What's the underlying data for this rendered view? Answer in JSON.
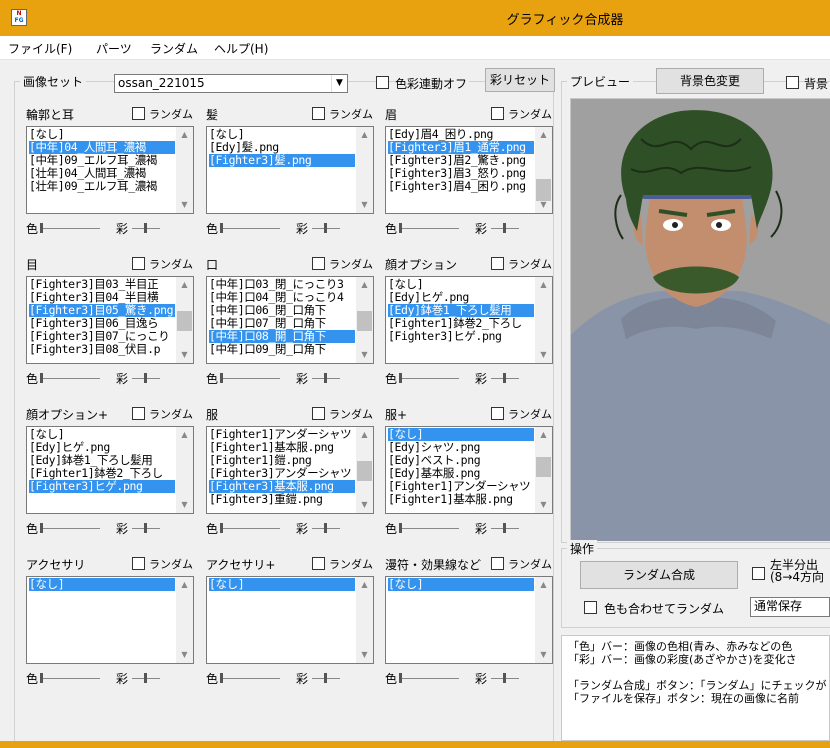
{
  "window": {
    "title": "グラフィック合成器"
  },
  "menu": [
    "ファイル(F)",
    "パーツ",
    "ランダム",
    "ヘルプ(H)"
  ],
  "image_set": {
    "label": "画像セット",
    "value": "ossan_221015",
    "color_link_label": "色彩連動オフ",
    "saturation_reset": "彩リセット"
  },
  "common": {
    "random": "ランダム",
    "color": "色",
    "saturation": "彩"
  },
  "parts": [
    {
      "label": "輪郭と耳",
      "items": [
        "[なし]",
        "[中年]04_人間耳_濃褐",
        "[中年]09_エルフ耳_濃褐",
        "[壮年]04_人間耳_濃褐",
        "[壮年]09_エルフ耳_濃褐"
      ],
      "selected": 1
    },
    {
      "label": "髪",
      "items": [
        "[なし]",
        "[Edy]髪.png",
        "[Fighter3]髪.png"
      ],
      "selected": 2
    },
    {
      "label": "眉",
      "items": [
        "[Edy]眉4_困り.png",
        "[Fighter3]眉1_通常.png",
        "[Fighter3]眉2_驚き.png",
        "[Fighter3]眉3_怒り.png",
        "[Fighter3]眉4_困り.png"
      ],
      "selected": 1
    },
    {
      "label": "目",
      "items": [
        "[Fighter3]目03_半目正",
        "[Fighter3]目04_半目横",
        "[Fighter3]目05_驚き.png",
        "[Fighter3]目06_目逸ら",
        "[Fighter3]目07_にっこり",
        "[Fighter3]目08_伏目.p"
      ],
      "selected": 2
    },
    {
      "label": "口",
      "items": [
        "[中年]口03_閉_にっこり3",
        "[中年]口04_閉_にっこり4",
        "[中年]口06_閉_口角下",
        "[中年]口07_閉_口角下",
        "[中年]口08_開_口角下",
        "[中年]口09_閉_口角下"
      ],
      "selected": 4
    },
    {
      "label": "顔オプション",
      "items": [
        "[なし]",
        "[Edy]ヒゲ.png",
        "[Edy]鉢巻1_下ろし髪用",
        "[Fighter1]鉢巻2_下ろし",
        "[Fighter3]ヒゲ.png"
      ],
      "selected": 2
    },
    {
      "label": "顔オプション+",
      "items": [
        "[なし]",
        "[Edy]ヒゲ.png",
        "[Edy]鉢巻1_下ろし髪用",
        "[Fighter1]鉢巻2_下ろし",
        "[Fighter3]ヒゲ.png"
      ],
      "selected": 4
    },
    {
      "label": "服",
      "items": [
        "[Fighter1]アンダーシャツ",
        "[Fighter1]基本服.png",
        "[Fighter1]鎧.png",
        "[Fighter3]アンダーシャツ",
        "[Fighter3]基本服.png",
        "[Fighter3]重鎧.png"
      ],
      "selected": 4
    },
    {
      "label": "服+",
      "items": [
        "[なし]",
        "[Edy]シャツ.png",
        "[Edy]ベスト.png",
        "[Edy]基本服.png",
        "[Fighter1]アンダーシャツ",
        "[Fighter1]基本服.png"
      ],
      "selected": 0
    },
    {
      "label": "アクセサリ",
      "items": [
        "[なし]"
      ],
      "selected": 0
    },
    {
      "label": "アクセサリ+",
      "items": [
        "[なし]"
      ],
      "selected": 0
    },
    {
      "label": "漫符・効果線など",
      "items": [
        "[なし]"
      ],
      "selected": 0
    }
  ],
  "preview": {
    "label": "プレビュー",
    "bg_button": "背景色変更",
    "bg_check": "背景"
  },
  "operations": {
    "label": "操作",
    "random_button": "ランダム合成",
    "color_random": "色も合わせてランダム",
    "split_line1": "左半分出",
    "split_line2": "(8→4方向",
    "save_mode": "通常保存"
  },
  "info": [
    "「色」バー：画像の色相(青み、赤みなどの色",
    "「彩」バー：画像の彩度(あざやかさ)を変化さ",
    "",
    "「ランダム合成」ボタン：「ランダム」にチェックが",
    "「ファイルを保存」ボタン：現在の画像に名前"
  ]
}
